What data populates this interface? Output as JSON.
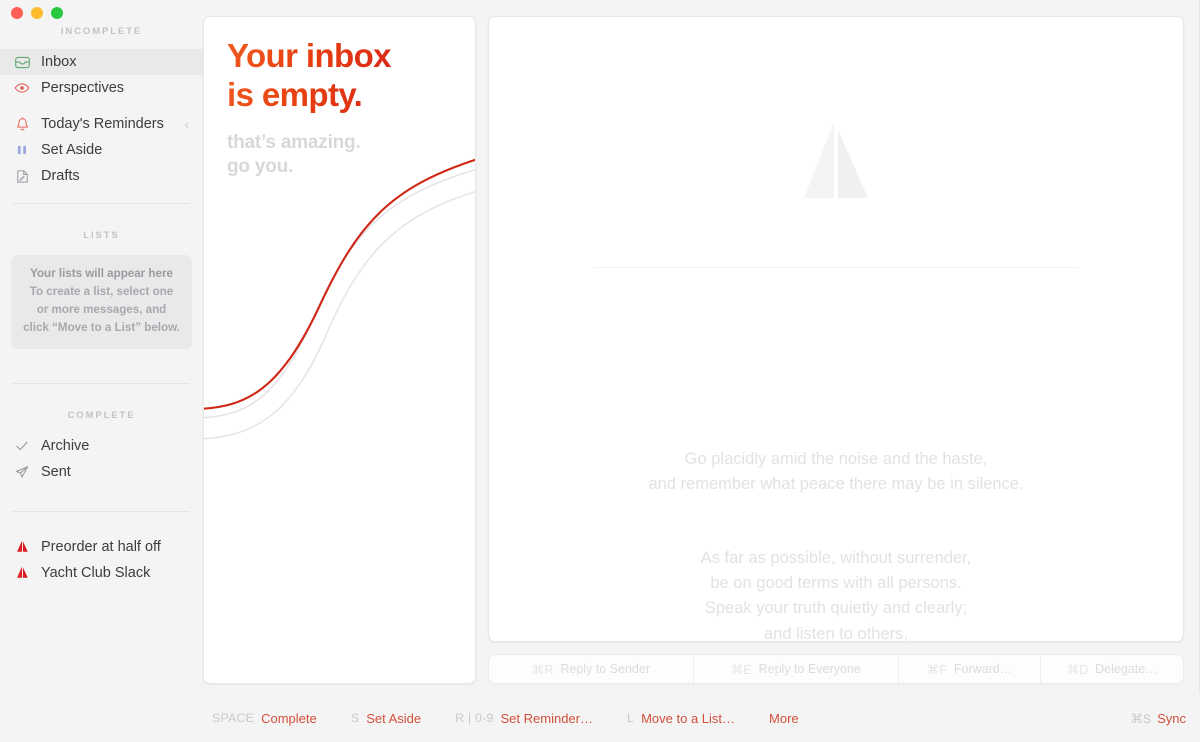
{
  "window": {
    "traffic_lights": [
      "close",
      "minimize",
      "maximize"
    ],
    "colors": {
      "close": "#ff5f57",
      "minimize": "#febc2e",
      "maximize": "#28c840",
      "accent_red": "#d2503c",
      "headline_from": "#f05a22",
      "headline_to": "#d9291a"
    }
  },
  "sidebar": {
    "section_incomplete": "Incomplete",
    "incomplete_items": [
      {
        "label": "Inbox",
        "icon": "inbox-tray-icon",
        "selected": true,
        "chevron": ""
      },
      {
        "label": "Perspectives",
        "icon": "eye-icon",
        "selected": false,
        "chevron": ""
      },
      {
        "label": "Today's Reminders",
        "icon": "bell-icon",
        "selected": false,
        "chevron": "‹"
      },
      {
        "label": "Set Aside",
        "icon": "pause-bars-icon",
        "selected": false,
        "chevron": ""
      },
      {
        "label": "Drafts",
        "icon": "draft-page-icon",
        "selected": false,
        "chevron": ""
      }
    ],
    "section_lists": "Lists",
    "lists_empty": {
      "line1": "Your lists will appear here",
      "body": "To create a list, select one or more messages, and click “Move to a List” below."
    },
    "section_complete": "Complete",
    "complete_items": [
      {
        "label": "Archive",
        "icon": "check-icon"
      },
      {
        "label": "Sent",
        "icon": "paper-plane-icon"
      }
    ],
    "account_items": [
      {
        "label": "Preorder at half off",
        "icon": "sail-icon"
      },
      {
        "label": "Yacht Club Slack",
        "icon": "sail-icon"
      }
    ]
  },
  "middle_panel": {
    "headline": "Your inbox\nis empty.",
    "subhead": "that’s amazing.\ngo you."
  },
  "message_panel": {
    "watermark_icon": "sail-watermark-icon",
    "quote_stanza_1": "Go placidly amid the noise and the haste,\nand remember what peace there may be in silence.",
    "quote_stanza_2": "As far as possible, without surrender,\nbe on good terms with all persons.\nSpeak your truth quietly and clearly;\nand listen to others,\neven to the dull and the ignorant;\nthey too have their story."
  },
  "reply_bar": {
    "buttons": [
      {
        "key": "⌘R",
        "label": "Reply to Sender"
      },
      {
        "key": "⌘E",
        "label": "Reply to Everyone"
      },
      {
        "key": "⌘F",
        "label": "Forward…"
      },
      {
        "key": "⌘D",
        "label": "Delegate…"
      }
    ]
  },
  "status_bar": {
    "items": [
      {
        "key": "SPACE",
        "label": "Complete"
      },
      {
        "key": "S",
        "label": "Set Aside"
      },
      {
        "key": "R | 0-9",
        "label": "Set Reminder…"
      },
      {
        "key": "L",
        "label": "Move to a List…"
      },
      {
        "key": "",
        "label": "More"
      }
    ],
    "sync": {
      "key": "⌘S",
      "label": "Sync"
    }
  }
}
